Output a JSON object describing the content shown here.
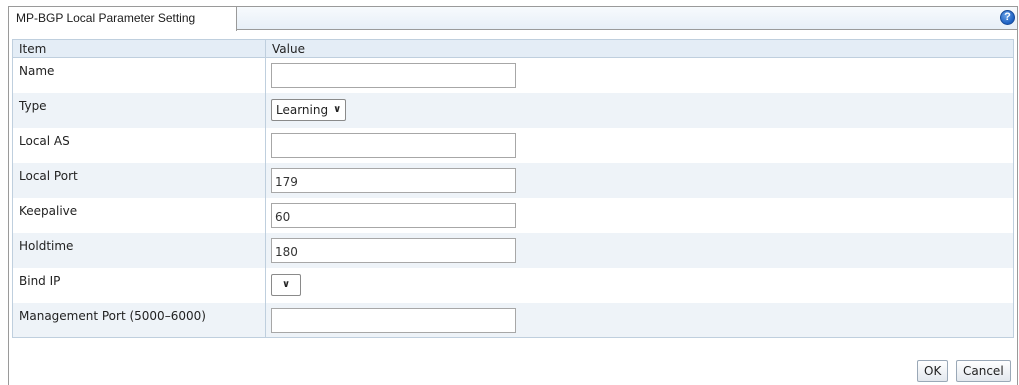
{
  "tab": {
    "title": "MP-BGP Local Parameter Setting"
  },
  "help_icon": "help-icon",
  "table": {
    "headers": {
      "item": "Item",
      "value": "Value"
    },
    "rows": [
      {
        "label": "Name",
        "control": "text",
        "value": ""
      },
      {
        "label": "Type",
        "control": "select",
        "value": "Learning"
      },
      {
        "label": "Local AS",
        "control": "text",
        "value": ""
      },
      {
        "label": "Local Port",
        "control": "text",
        "value": "179"
      },
      {
        "label": "Keepalive",
        "control": "text",
        "value": "60"
      },
      {
        "label": "Holdtime",
        "control": "text",
        "value": "180"
      },
      {
        "label": "Bind IP",
        "control": "select",
        "value": ""
      },
      {
        "label": "Management Port (5000–6000)",
        "control": "text",
        "value": ""
      }
    ]
  },
  "buttons": {
    "ok": "OK",
    "cancel": "Cancel"
  }
}
